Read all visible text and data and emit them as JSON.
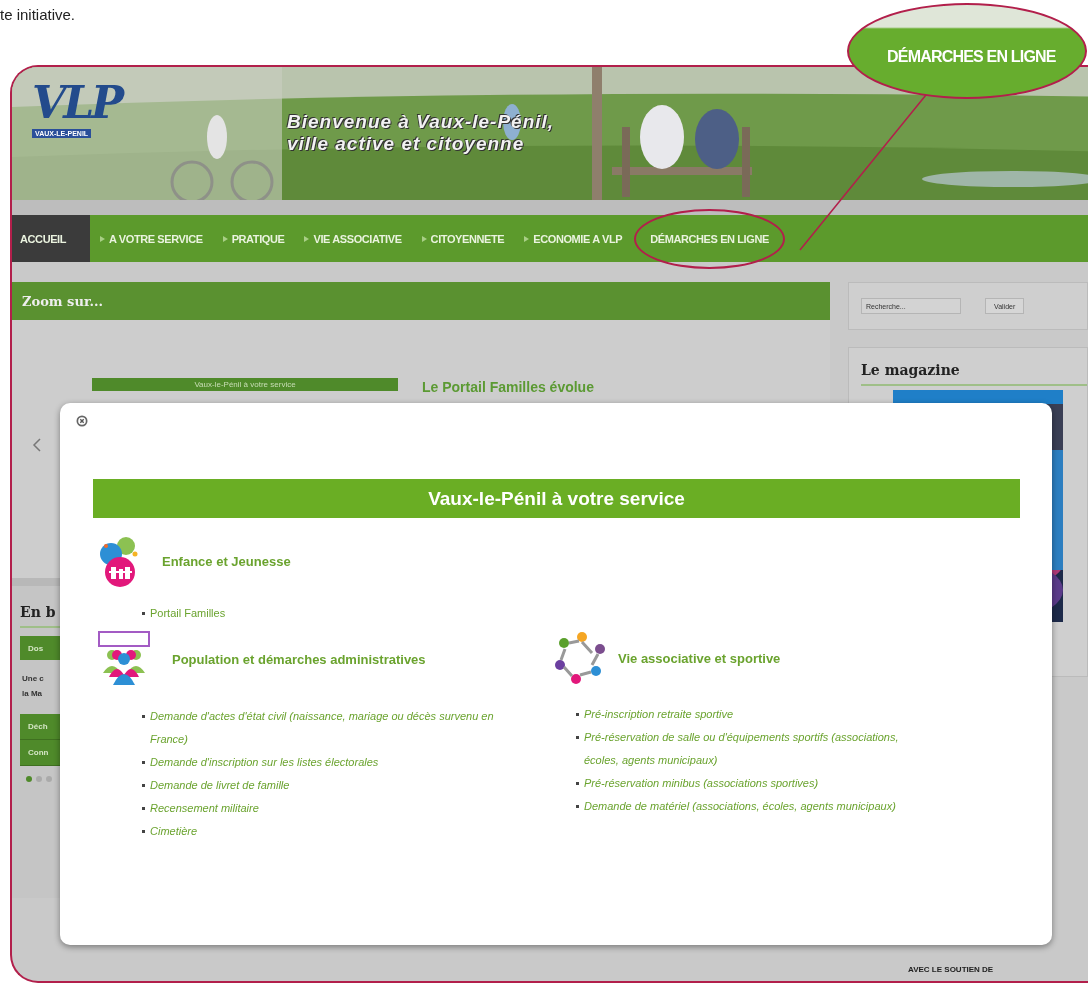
{
  "document_text": "te initiative.",
  "callout": {
    "label": "DÉMARCHES EN LIGNE"
  },
  "header": {
    "logo": "VLP",
    "logo_caption": "VAUX-LE-PENIL",
    "tagline": [
      "Bienvenue à Vaux-le-Pénil,",
      "ville active et citoyenne"
    ]
  },
  "nav": [
    {
      "label": "ACCUEIL",
      "selected": true,
      "submenu": false,
      "circled": false
    },
    {
      "label": "A VOTRE SERVICE",
      "selected": false,
      "submenu": true,
      "circled": false
    },
    {
      "label": "PRATIQUE",
      "selected": false,
      "submenu": true,
      "circled": false
    },
    {
      "label": "VIE ASSOCIATIVE",
      "selected": false,
      "submenu": true,
      "circled": false
    },
    {
      "label": "CITOYENNETE",
      "selected": false,
      "submenu": true,
      "circled": false
    },
    {
      "label": "ECONOMIE A VLP",
      "selected": false,
      "submenu": true,
      "circled": false
    },
    {
      "label": "DÉMARCHES EN LIGNE",
      "selected": false,
      "submenu": false,
      "circled": true
    }
  ],
  "zoom": {
    "title": "Zoom sur...",
    "slide_caption": "Vaux-le-Pénil à votre service",
    "slide_title": "Le Portail Familles évolue"
  },
  "brief": {
    "title": "En b",
    "tab": "Dos",
    "text_lines": [
      "Une c",
      "la Ma"
    ],
    "buttons": [
      "Déch",
      "Conn"
    ],
    "dots": [
      {
        "selected": true
      },
      {
        "selected": false
      },
      {
        "selected": false
      }
    ]
  },
  "sidebar": {
    "search": {
      "placeholder": "Recherche...",
      "button": "Valider"
    },
    "magazine_title": "Le magazine",
    "footer": "AVEC LE SOUTIEN DE"
  },
  "modal": {
    "title": "Vaux-le-Pénil à votre service",
    "sections": [
      {
        "kind": "children",
        "heading": "Enfance et Jeunesse",
        "italic": false,
        "links": [
          "Portail Familles"
        ]
      },
      {
        "kind": "people",
        "heading": "Population et démarches administratives",
        "italic": true,
        "links": [
          "Demande d'actes d'état civil (naissance, mariage ou décès survenu en France)",
          "Demande d'inscription sur les listes électorales",
          "Demande de livret de famille",
          "Recensement militaire",
          "Cimetière"
        ]
      },
      {
        "kind": "community",
        "heading": "Vie associative et sportive",
        "italic": true,
        "links": [
          "Pré-inscription retraite sportive",
          "Pré-réservation de salle ou d'équipements sportifs (associations, écoles, agents municipaux)",
          "Pré-réservation minibus (associations sportives)",
          "Demande de matériel (associations, écoles, agents municipaux)"
        ]
      }
    ]
  }
}
